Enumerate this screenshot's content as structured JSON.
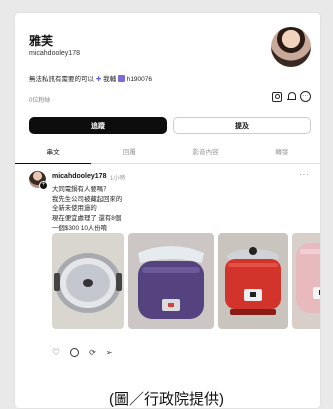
{
  "profile": {
    "name": "雅芙",
    "handle": "micahdooley178",
    "bio": "無法私訊有需要的可以",
    "bio_bolt": "✚",
    "bio_contact": "我輔",
    "bio_id": "h190076",
    "followers": "0位粉絲"
  },
  "buttons": {
    "follow": "追蹤",
    "mention": "提及"
  },
  "tabs": [
    "串文",
    "回覆",
    "影音內容",
    "轉發"
  ],
  "post": {
    "user": "micahdooley178",
    "time": "1小時",
    "more": "···",
    "lines": [
      "大同電鍋有人要嗎？",
      "我先生公司被藏起回來的",
      "全新未使用過的",
      "現在便宜處理了 還有8個",
      "一個$300 10人份唷"
    ]
  },
  "colors": {
    "follow_bg": "#0d0d0d",
    "accent": "#5b63d6"
  },
  "caption": "(圖／行政院提供)"
}
